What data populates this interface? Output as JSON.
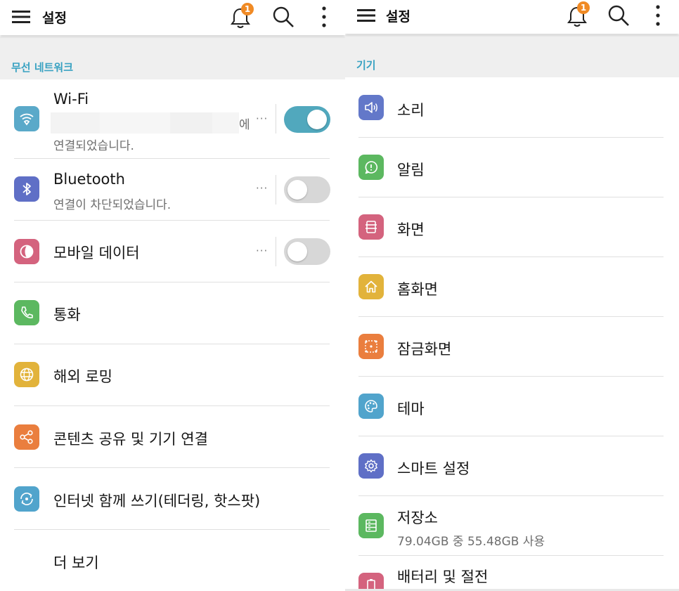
{
  "colors": {
    "accent": "#39a2c2",
    "badge": "#f08a24",
    "toggle_on": "#51a8bd",
    "toggle_off": "#d7d7d7",
    "section_bg": "#efefef"
  },
  "left": {
    "appbar": {
      "title": "설정",
      "notification_count": "1"
    },
    "section_label": "무선 네트워크",
    "items": [
      {
        "label": "Wi-Fi",
        "sub_suffix": "에",
        "sub_line2": "연결되었습니다.",
        "more": "···",
        "toggle": "on",
        "icon": "wifi-icon",
        "color": "#5aa9c9"
      },
      {
        "label": "Bluetooth",
        "sub": "연결이 차단되었습니다.",
        "more": "···",
        "toggle": "off",
        "icon": "bluetooth-icon",
        "color": "#5f6fc6"
      },
      {
        "label": "모바일 데이터",
        "more": "···",
        "toggle": "off",
        "icon": "mobile-data-icon",
        "color": "#d4637e"
      },
      {
        "label": "통화",
        "icon": "phone-icon",
        "color": "#5cb860"
      },
      {
        "label": "해외 로밍",
        "icon": "globe-icon",
        "color": "#e2b33b"
      },
      {
        "label": "콘텐츠 공유 및 기기 연결",
        "icon": "share-icon",
        "color": "#ea7e3e"
      },
      {
        "label": "인터넷 함께 쓰기(테더링, 핫스팟)",
        "icon": "tethering-icon",
        "color": "#51a4cc"
      },
      {
        "label": "더 보기",
        "icon": ""
      }
    ]
  },
  "right": {
    "appbar": {
      "title": "설정",
      "notification_count": "1"
    },
    "section_label": "기기",
    "items": [
      {
        "label": "소리",
        "icon": "speaker-icon",
        "color": "#6378c9"
      },
      {
        "label": "알림",
        "icon": "alert-icon",
        "color": "#5cb860"
      },
      {
        "label": "화면",
        "icon": "display-icon",
        "color": "#d4637e"
      },
      {
        "label": "홈화면",
        "icon": "home-icon",
        "color": "#e2b33b"
      },
      {
        "label": "잠금화면",
        "icon": "lock-screen-icon",
        "color": "#ea7e3e"
      },
      {
        "label": "테마",
        "icon": "palette-icon",
        "color": "#51a4cc"
      },
      {
        "label": "스마트 설정",
        "icon": "gear-icon",
        "color": "#5f6fc6"
      },
      {
        "label": "저장소",
        "sub": "79.04GB 중 55.48GB 사용",
        "icon": "storage-icon",
        "color": "#5cb860"
      },
      {
        "label": "배터리 및 절전",
        "icon": "battery-icon",
        "color": "#d4637e"
      }
    ]
  }
}
